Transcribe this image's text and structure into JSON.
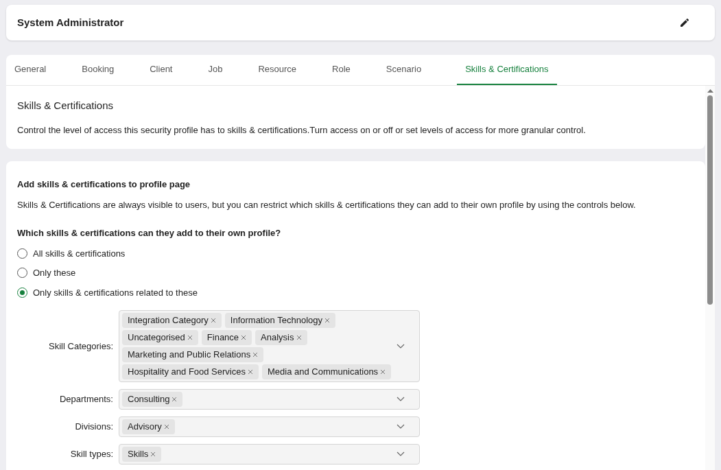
{
  "header": {
    "title": "System Administrator"
  },
  "tabs": [
    {
      "label": "General",
      "selected": false
    },
    {
      "label": "Booking",
      "selected": false
    },
    {
      "label": "Client",
      "selected": false
    },
    {
      "label": "Job",
      "selected": false
    },
    {
      "label": "Resource",
      "selected": false
    },
    {
      "label": "Role",
      "selected": false
    },
    {
      "label": "Scenario",
      "selected": false
    },
    {
      "label": "Skills & Certifications",
      "selected": true
    }
  ],
  "intro": {
    "title": "Skills & Certifications",
    "description": "Control the level of access this security profile has to skills & certifications.Turn access on or off or set levels of access for more granular control."
  },
  "profile_section": {
    "title": "Add skills & certifications to profile page",
    "description": "Skills & Certifications are always visible to users, but you can restrict which skills & certifications they can add to their own profile by using the controls below.",
    "question": "Which skills & certifications can they add to their own profile?",
    "options": [
      {
        "label": "All skills & certifications",
        "selected": false
      },
      {
        "label": "Only these",
        "selected": false
      },
      {
        "label": "Only skills & certifications related to these",
        "selected": true
      }
    ],
    "filters": [
      {
        "label": "Skill Categories:",
        "tags": [
          "Integration Category",
          "Information Technology",
          "Uncategorised",
          "Finance",
          "Analysis",
          "Marketing and Public Relations",
          "Hospitality and Food Services",
          "Media and Communications"
        ]
      },
      {
        "label": "Departments:",
        "tags": [
          "Consulting"
        ]
      },
      {
        "label": "Divisions:",
        "tags": [
          "Advisory"
        ]
      },
      {
        "label": "Skill types:",
        "tags": [
          "Skills"
        ]
      }
    ]
  }
}
